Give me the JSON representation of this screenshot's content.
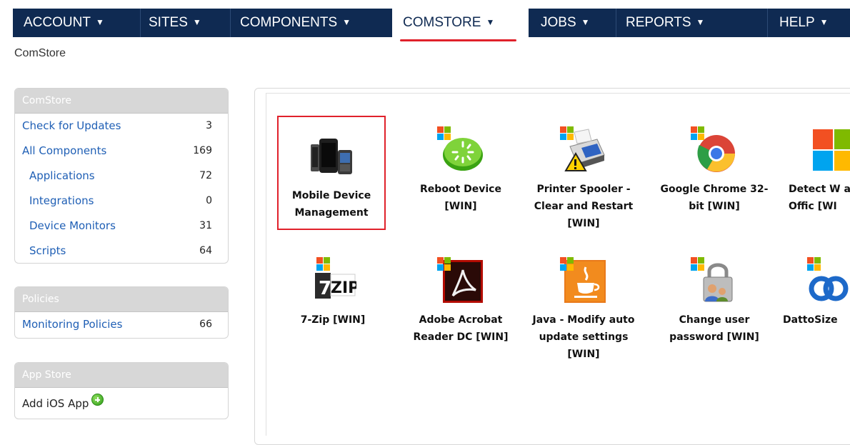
{
  "nav": {
    "items": [
      {
        "label": "ACCOUNT"
      },
      {
        "label": "SITES"
      },
      {
        "label": "COMPONENTS"
      },
      {
        "label": "COMSTORE"
      },
      {
        "label": "JOBS"
      },
      {
        "label": "REPORTS"
      },
      {
        "label": "HELP"
      }
    ],
    "active": "COMSTORE",
    "arrow": "▼",
    "bg_color": "#0f2a52",
    "active_underline_color": "#e0212b"
  },
  "breadcrumb": "ComStore",
  "sidebar": {
    "comstore": {
      "title": "ComStore",
      "rows": [
        {
          "label": "Check for Updates",
          "count": "3"
        },
        {
          "label": "All Components",
          "count": "169"
        },
        {
          "label": "Applications",
          "count": "72"
        },
        {
          "label": "Integrations",
          "count": "0"
        },
        {
          "label": "Device Monitors",
          "count": "31"
        },
        {
          "label": "Scripts",
          "count": "64"
        }
      ]
    },
    "policies": {
      "title": "Policies",
      "rows": [
        {
          "label": "Monitoring Policies",
          "count": "66"
        }
      ]
    },
    "appstore": {
      "title": "App Store",
      "rows": [
        {
          "label": "Add iOS App",
          "icon": "add-circle-icon"
        }
      ]
    }
  },
  "components": [
    {
      "name": "Mobile Device Management",
      "icon": "mobile-devices-icon",
      "selected": true
    },
    {
      "name": "Reboot Device [WIN]",
      "icon": "reboot-icon"
    },
    {
      "name": "Printer Spooler - Clear and Restart [WIN]",
      "icon": "printer-warning-icon"
    },
    {
      "name": "Google Chrome 32-bit [WIN]",
      "icon": "chrome-icon"
    },
    {
      "name": "Detect W and Offic [WI",
      "icon": "windows-office-icon"
    },
    {
      "name": "7-Zip [WIN]",
      "icon": "7zip-icon"
    },
    {
      "name": "Adobe Acrobat Reader DC [WIN]",
      "icon": "acrobat-icon"
    },
    {
      "name": "Java - Modify auto update settings [WIN]",
      "icon": "java-icon"
    },
    {
      "name": "Change user password [WIN]",
      "icon": "lock-user-icon"
    },
    {
      "name": "DattoSize",
      "icon": "datto-icon"
    }
  ],
  "icon_text": {
    "zip": "ZIP",
    "seven": "7"
  }
}
